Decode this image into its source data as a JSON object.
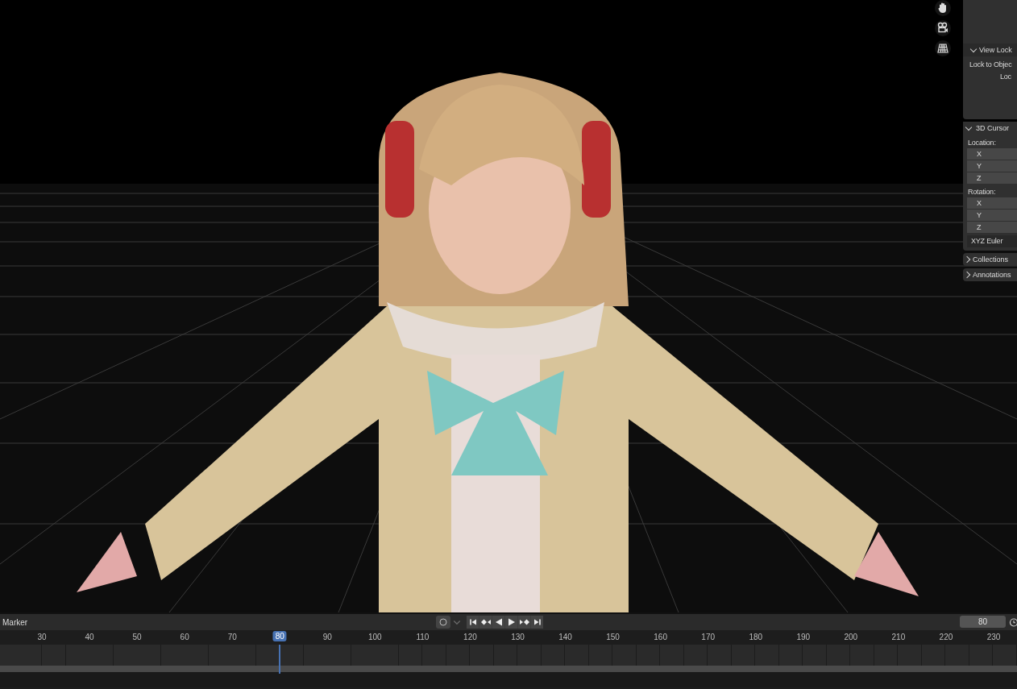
{
  "side_panel": {
    "sections": [
      {
        "kind": "lock",
        "title": "View Lock",
        "expanded": true,
        "rows": [
          "Lock to Objec",
          "Loc"
        ]
      },
      {
        "kind": "cursor",
        "title": "3D Cursor",
        "expanded": true,
        "groups": [
          {
            "label": "Location:",
            "axes": [
              "X",
              "Y",
              "Z"
            ]
          },
          {
            "label": "Rotation:",
            "axes": [
              "X",
              "Y",
              "Z"
            ]
          }
        ],
        "mode": "XYZ Euler"
      },
      {
        "kind": "plain",
        "title": "Collections",
        "expanded": false
      },
      {
        "kind": "plain",
        "title": "Annotations",
        "expanded": false
      }
    ]
  },
  "timeline": {
    "menu": "Marker",
    "frame_field": "80",
    "ruler": [
      {
        "label": "30",
        "selected": false
      },
      {
        "label": "40",
        "selected": false
      },
      {
        "label": "50",
        "selected": false
      },
      {
        "label": "60",
        "selected": false
      },
      {
        "label": "70",
        "selected": false
      },
      {
        "label": "80",
        "selected": true
      },
      {
        "label": "90",
        "selected": false
      },
      {
        "label": "100",
        "selected": false
      },
      {
        "label": "110",
        "selected": false
      },
      {
        "label": "120",
        "selected": false
      },
      {
        "label": "130",
        "selected": false
      },
      {
        "label": "140",
        "selected": false
      },
      {
        "label": "150",
        "selected": false
      },
      {
        "label": "160",
        "selected": false
      },
      {
        "label": "170",
        "selected": false
      },
      {
        "label": "180",
        "selected": false
      },
      {
        "label": "190",
        "selected": false
      },
      {
        "label": "200",
        "selected": false
      },
      {
        "label": "210",
        "selected": false
      },
      {
        "label": "220",
        "selected": false
      },
      {
        "label": "230",
        "selected": false
      }
    ]
  }
}
